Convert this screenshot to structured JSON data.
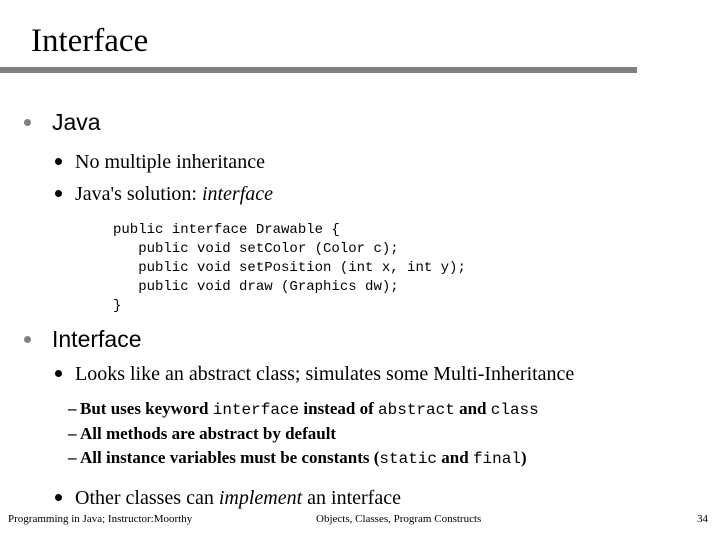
{
  "slide": {
    "title": "Interface",
    "rule_color": "#808080",
    "bullet_level1_color": "#808080",
    "bullet_level2_color": "#000000"
  },
  "sections": [
    {
      "heading": "Java",
      "items": [
        {
          "text": "No multiple inheritance"
        },
        {
          "text_before": "Java's solution: ",
          "emphasis": "interface"
        }
      ],
      "code": "public interface Drawable {\n   public void setColor (Color c);\n   public void setPosition (int x, int y);\n   public void draw (Graphics dw);\n}"
    },
    {
      "heading": "Interface",
      "items": [
        {
          "text": "Looks like an abstract class; simulates some Multi-Inheritance"
        },
        {
          "text_before": "Other classes can ",
          "emphasis": "implement",
          "text_after": " an interface"
        }
      ],
      "subitems": [
        {
          "dash": "–",
          "part1": "But uses keyword ",
          "code1": "interface",
          "part2": "  instead of ",
          "code2": "abstract",
          "part3": "  and ",
          "code3": "class",
          "part4": ""
        },
        {
          "dash": "–",
          "part1": "All methods are abstract by default",
          "code1": "",
          "part2": "",
          "code2": "",
          "part3": "",
          "code3": "",
          "part4": ""
        },
        {
          "dash": "–",
          "part1": "All instance variables must be constants (",
          "code1": "static",
          "part2": "  and ",
          "code2": "final",
          "part3": ")",
          "code3": "",
          "part4": ""
        }
      ]
    }
  ],
  "footer": {
    "left": "Programming in Java; Instructor:Moorthy",
    "center": "Objects, Classes, Program Constructs",
    "right": "34"
  }
}
